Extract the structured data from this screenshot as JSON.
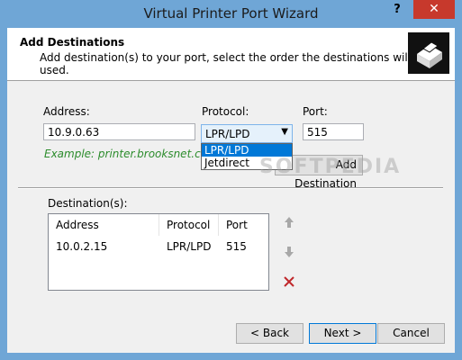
{
  "window": {
    "title": "Virtual Printer Port Wizard",
    "help": "?",
    "close": "✕"
  },
  "header": {
    "title": "Add Destinations",
    "subtitle": "Add destination(s) to your port, select the order the destinations will be used."
  },
  "form": {
    "address_label": "Address:",
    "address_value": "10.9.0.63",
    "protocol_label": "Protocol:",
    "protocol_value": "LPR/LPD",
    "port_label": "Port:",
    "port_value": "515",
    "example": "Example: printer.brooksnet.com",
    "protocol_options": [
      "LPR/LPD",
      "Jetdirect"
    ],
    "add_button": "Add Destination"
  },
  "destinations": {
    "label": "Destination(s):",
    "columns": [
      "Address",
      "Protocol",
      "Port"
    ],
    "rows": [
      [
        "10.0.2.15",
        "LPR/LPD",
        "515"
      ]
    ]
  },
  "footer": {
    "back": "< Back",
    "next": "Next >",
    "cancel": "Cancel"
  },
  "watermark": "SOFTPEDIA",
  "colors": {
    "titlebar": "#6fa6d6",
    "close": "#c7392c",
    "example": "#2c8c2c",
    "selected": "#0078d7"
  },
  "icons": {
    "move_up": "arrow-up-icon",
    "move_down": "arrow-down-icon",
    "remove": "delete-x-icon",
    "printer": "printer-icon"
  }
}
